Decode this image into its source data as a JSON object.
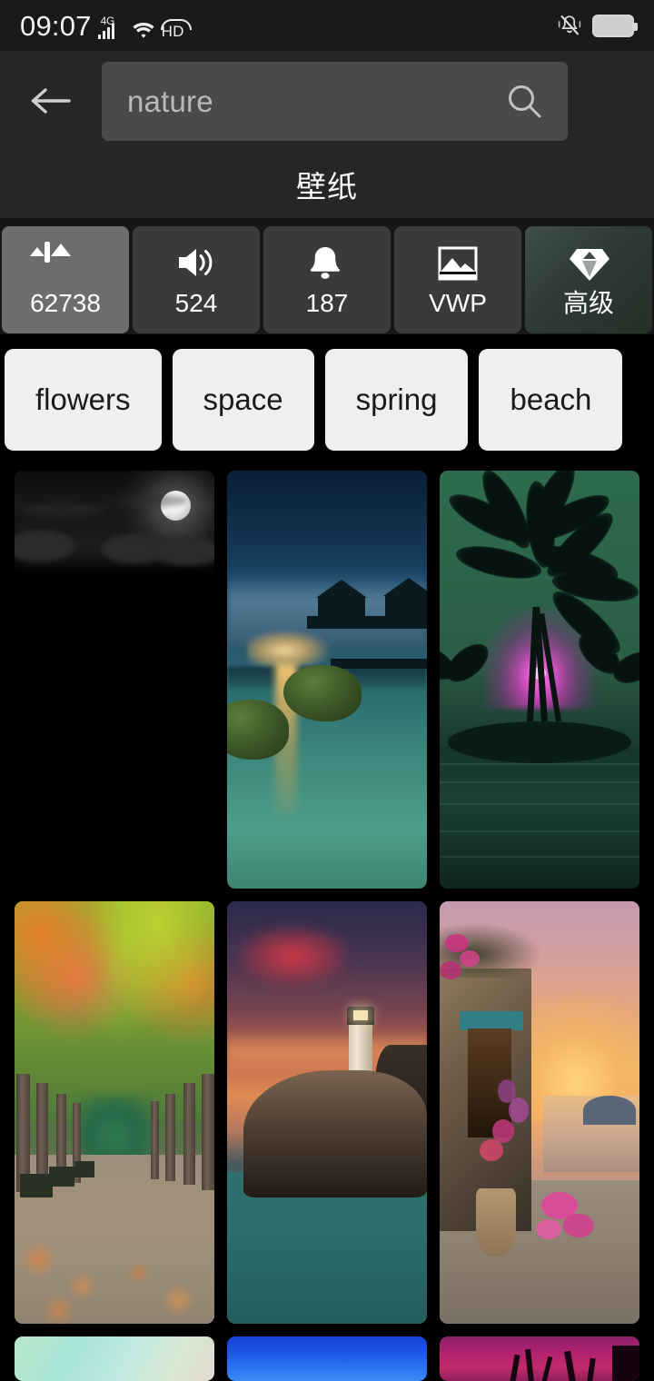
{
  "statusbar": {
    "time": "09:07",
    "network_type": "4G",
    "hd_label": "HD",
    "icons": [
      "signal-icon",
      "wifi-icon",
      "hd-icon",
      "mute-icon",
      "battery-icon"
    ]
  },
  "header": {
    "back_icon": "back-arrow-icon",
    "search_value": "nature",
    "search_placeholder": "nature",
    "search_icon": "search-icon",
    "title": "壁纸"
  },
  "tabs": [
    {
      "id": "wallpapers",
      "icon": "image-icon",
      "label": "62738",
      "selected": true,
      "premium": false
    },
    {
      "id": "ringtones",
      "icon": "speaker-icon",
      "label": "524",
      "selected": false,
      "premium": false
    },
    {
      "id": "notifications",
      "icon": "bell-icon",
      "label": "187",
      "selected": false,
      "premium": false
    },
    {
      "id": "live",
      "icon": "live-wallpaper-icon",
      "label": "VWP",
      "selected": false,
      "premium": false
    },
    {
      "id": "premium",
      "icon": "diamond-icon",
      "label": "高级",
      "selected": false,
      "premium": true
    }
  ],
  "chips": [
    {
      "label": "flowers"
    },
    {
      "label": "space"
    },
    {
      "label": "spring"
    },
    {
      "label": "beach"
    }
  ],
  "grid": {
    "items": [
      {
        "id": "moon-clouds",
        "alt": "full moon above dark clouds at night"
      },
      {
        "id": "lagoon-sunset",
        "alt": "sunset over calm water with gazebos and mossy rocks"
      },
      {
        "id": "palm-silhouette",
        "alt": "palm trees silhouetted against green sky with magenta sunset"
      },
      {
        "id": "autumn-path",
        "alt": "autumn tree lined path with benches and fallen leaves"
      },
      {
        "id": "lighthouse-cliff",
        "alt": "lighthouse on rocky cliff at sunset over teal sea"
      },
      {
        "id": "seaside-flowers",
        "alt": "mediterranean seaside street with flowers at sunset"
      },
      {
        "id": "mint-gradient",
        "alt": "soft mint and teal gradient abstract"
      },
      {
        "id": "blue-gradient",
        "alt": "deep blue gradient abstract"
      },
      {
        "id": "neon-palms",
        "alt": "magenta neon sky with palm silhouettes"
      }
    ]
  },
  "colors": {
    "background": "#000000",
    "header_bg": "#262626",
    "statusbar_bg": "#1a1a1a",
    "search_field": "#4a4a4a",
    "tab_bg": "#3a3a3a",
    "tab_selected_bg": "#6d6d6d",
    "premium_accent": "#3f4f4a",
    "chip_bg": "#efefef",
    "chip_text": "#1a1a1a",
    "text_primary": "#ffffff"
  }
}
